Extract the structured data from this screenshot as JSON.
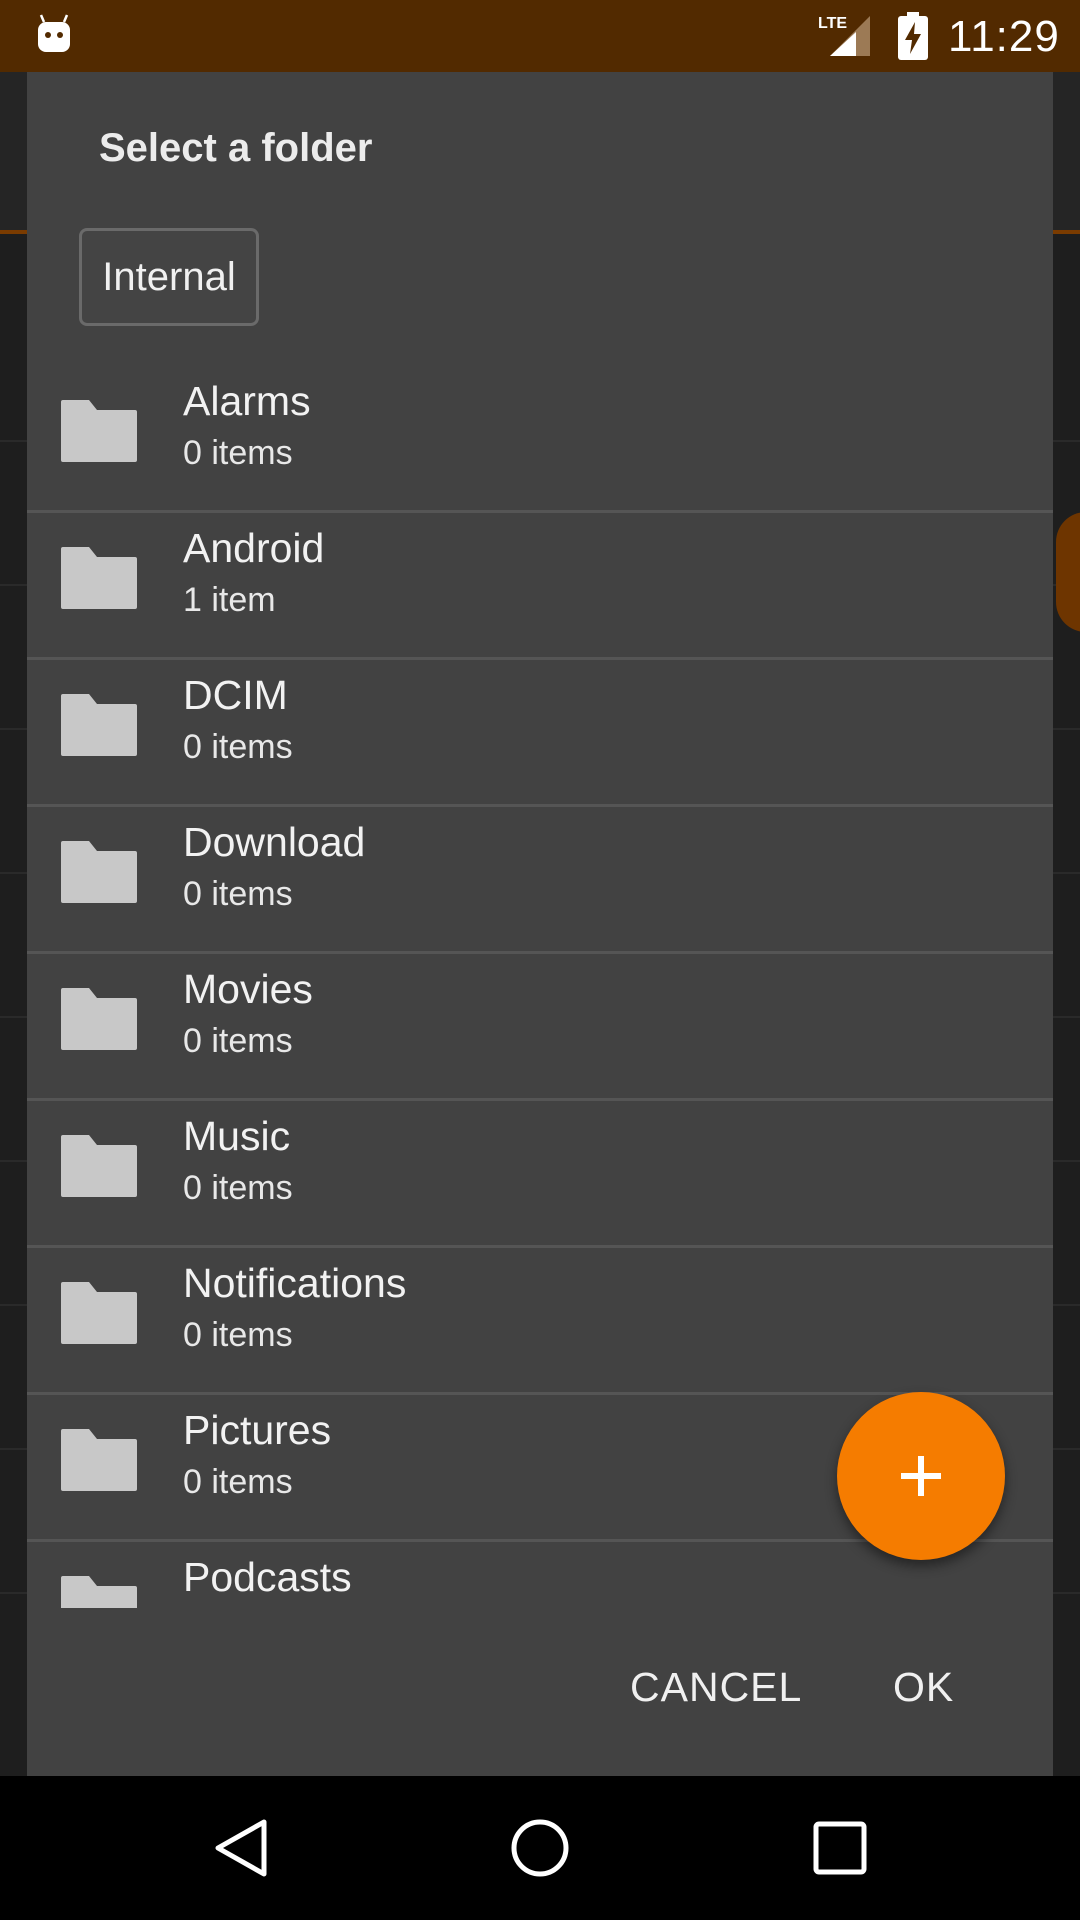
{
  "status_bar": {
    "time": "11:29",
    "network": "LTE",
    "app_icon": "android-icon",
    "battery_icon": "battery-charging-icon"
  },
  "dialog": {
    "title": "Select a folder",
    "storage_selector": "Internal",
    "folders": [
      {
        "name": "Alarms",
        "count": "0 items"
      },
      {
        "name": "Android",
        "count": "1 item"
      },
      {
        "name": "DCIM",
        "count": "0 items"
      },
      {
        "name": "Download",
        "count": "0 items"
      },
      {
        "name": "Movies",
        "count": "0 items"
      },
      {
        "name": "Music",
        "count": "0 items"
      },
      {
        "name": "Notifications",
        "count": "0 items"
      },
      {
        "name": "Pictures",
        "count": "0 items"
      },
      {
        "name": "Podcasts",
        "count": ""
      }
    ],
    "fab_icon": "plus-icon",
    "cancel_label": "CANCEL",
    "ok_label": "OK"
  },
  "colors": {
    "status_bar": "#522a00",
    "dialog_bg": "#424242",
    "accent": "#f57c00",
    "folder_icon": "#c8c8c8"
  }
}
